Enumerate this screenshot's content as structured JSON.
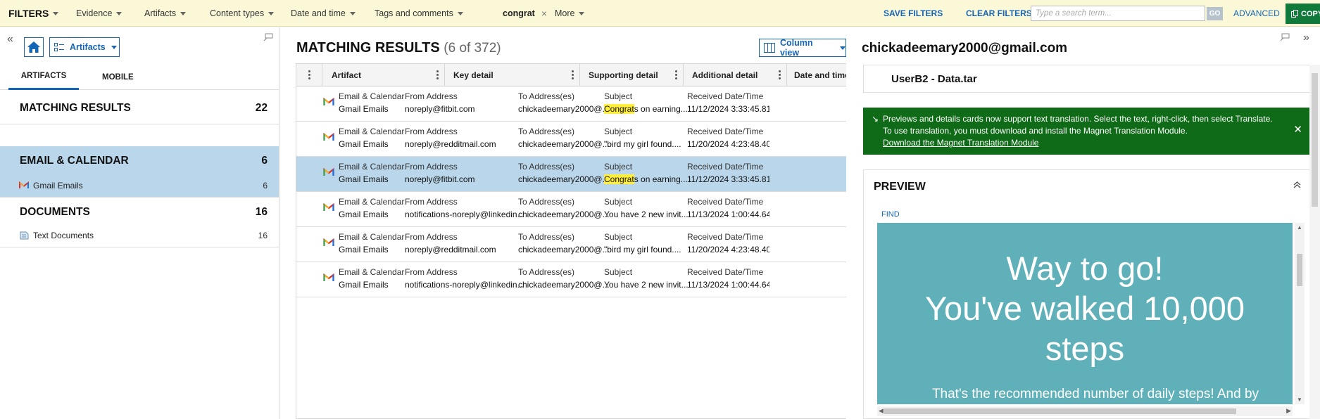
{
  "filters": {
    "title": "FILTERS",
    "menus": [
      "Evidence",
      "Artifacts",
      "Content types",
      "Date and time",
      "Tags and comments"
    ],
    "chip": "congrat",
    "chip_close": "×",
    "more": "More",
    "save": "SAVE FILTERS",
    "clear": "CLEAR FILTERS",
    "search_placeholder": "Type a search term...",
    "go": "GO",
    "advanced": "ADVANCED",
    "copy": "COPY"
  },
  "left": {
    "artifacts_select": "Artifacts",
    "tabs": [
      "ARTIFACTS",
      "MOBILE"
    ],
    "matching": {
      "label": "MATCHING RESULTS",
      "count": "22"
    },
    "email": {
      "label": "EMAIL & CALENDAR",
      "count": "6"
    },
    "gmail": {
      "label": "Gmail Emails",
      "count": "6"
    },
    "documents": {
      "label": "DOCUMENTS",
      "count": "16"
    },
    "textdocs": {
      "label": "Text Documents",
      "count": "16"
    }
  },
  "results": {
    "title": "MATCHING RESULTS",
    "count": "(6 of 372)",
    "column_view": "Column view",
    "columns": [
      "Artifact",
      "Key detail",
      "Supporting detail",
      "Additional detail",
      "Date and time"
    ],
    "rows": [
      {
        "cat": "Email & Calendar",
        "type": "Gmail Emails",
        "key_l": "From Address",
        "key_v": "noreply@fitbit.com",
        "sup_l": "To Address(es)",
        "sup_v": "chickadeemary2000@...",
        "add_l": "Subject",
        "add_hl": "Congrat",
        "add_rest": "s on earning...",
        "date_l": "Received Date/Time",
        "date_v": "11/12/2024 3:33:45.81"
      },
      {
        "cat": "Email & Calendar",
        "type": "Gmail Emails",
        "key_l": "From Address",
        "key_v": "noreply@redditmail.com",
        "sup_l": "To Address(es)",
        "sup_v": "chickadeemary2000@...",
        "add_l": "Subject",
        "add_hl": "",
        "add_rest": "\"bird my girl found....",
        "date_l": "Received Date/Time",
        "date_v": "11/20/2024 4:23:48.40"
      },
      {
        "cat": "Email & Calendar",
        "type": "Gmail Emails",
        "key_l": "From Address",
        "key_v": "noreply@fitbit.com",
        "sup_l": "To Address(es)",
        "sup_v": "chickadeemary2000@...",
        "add_l": "Subject",
        "add_hl": "Congrat",
        "add_rest": "s on earning...",
        "date_l": "Received Date/Time",
        "date_v": "11/12/2024 3:33:45.81"
      },
      {
        "cat": "Email & Calendar",
        "type": "Gmail Emails",
        "key_l": "From Address",
        "key_v": "notifications-noreply@linkedin...",
        "sup_l": "To Address(es)",
        "sup_v": "chickadeemary2000@...",
        "add_l": "Subject",
        "add_hl": "",
        "add_rest": "You have 2 new invit...",
        "date_l": "Received Date/Time",
        "date_v": "11/13/2024 1:00:44.64"
      },
      {
        "cat": "Email & Calendar",
        "type": "Gmail Emails",
        "key_l": "From Address",
        "key_v": "noreply@redditmail.com",
        "sup_l": "To Address(es)",
        "sup_v": "chickadeemary2000@...",
        "add_l": "Subject",
        "add_hl": "",
        "add_rest": "\"bird my girl found....",
        "date_l": "Received Date/Time",
        "date_v": "11/20/2024 4:23:48.40"
      },
      {
        "cat": "Email & Calendar",
        "type": "Gmail Emails",
        "key_l": "From Address",
        "key_v": "notifications-noreply@linkedin...",
        "sup_l": "To Address(es)",
        "sup_v": "chickadeemary2000@...",
        "add_l": "Subject",
        "add_hl": "",
        "add_rest": "You have 2 new invit...",
        "date_l": "Received Date/Time",
        "date_v": "11/13/2024 1:00:44.64"
      }
    ]
  },
  "detail": {
    "title": "chickadeemary2000@gmail.com",
    "source": "UserB2 - Data.tar",
    "notice": {
      "line1": "Previews and details cards now support text translation. Select the text, right-click, then select Translate.",
      "line2": "To use translation, you must download and install the Magnet Translation Module.",
      "link": "Download the Magnet Translation Module",
      "close": "✕"
    },
    "preview_title": "PREVIEW",
    "find": "FIND",
    "email_headline": [
      "Way to go!",
      "You've walked 10,000",
      "steps"
    ],
    "email_body": "That's the recommended number of daily steps! And by stepping up your game, you've achieved the Sneakers badge"
  }
}
